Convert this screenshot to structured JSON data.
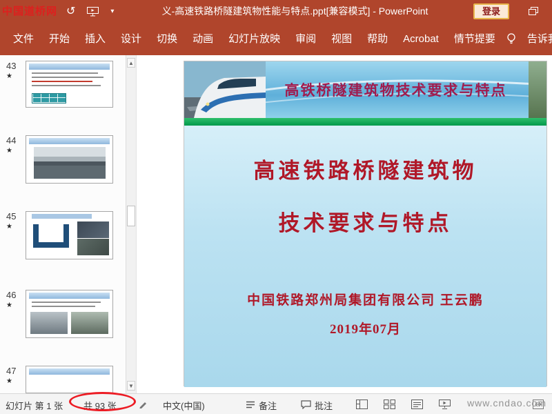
{
  "colors": {
    "titlebar_bg": "#B0452C",
    "banner_title_red": "#A01C4E",
    "body_text_red": "#B01828",
    "green_bar": "#00A651",
    "annotation_red": "#EC1C24"
  },
  "watermarks": {
    "top_left": "中国道桥网",
    "bottom_right": "www.cndao.com"
  },
  "icons": {
    "undo": "↺",
    "qat_more": "▾",
    "scroll_up": "▲",
    "scroll_down": "▼",
    "star": "★"
  },
  "titlebar": {
    "title": "义-高速铁路桥隧建筑物性能与特点.ppt[兼容模式] - PowerPoint",
    "login_label": "登录"
  },
  "ribbon": {
    "tabs": [
      {
        "label": "文件"
      },
      {
        "label": "开始"
      },
      {
        "label": "插入"
      },
      {
        "label": "设计"
      },
      {
        "label": "切换"
      },
      {
        "label": "动画"
      },
      {
        "label": "幻灯片放映"
      },
      {
        "label": "审阅"
      },
      {
        "label": "视图"
      },
      {
        "label": "帮助"
      },
      {
        "label": "Acrobat"
      },
      {
        "label": "情节提要"
      }
    ],
    "tell_me": "告诉我"
  },
  "thumbnail_panel": {
    "slides": [
      {
        "number": "43"
      },
      {
        "number": "44"
      },
      {
        "number": "45"
      },
      {
        "number": "46"
      },
      {
        "number": "47"
      }
    ]
  },
  "slide": {
    "banner_title": "高铁桥隧建筑物技术要求与特点",
    "title_line1": "高速铁路桥隧建筑物",
    "title_line2": "技术要求与特点",
    "author": "中国铁路郑州局集团有限公司 王云鹏",
    "date": "2019年07月"
  },
  "statusbar": {
    "slide_position": "幻灯片 第 1 张",
    "slide_count": "共 93 张",
    "language": "中文(中国)",
    "notes_label": "备注",
    "comments_label": "批注"
  }
}
